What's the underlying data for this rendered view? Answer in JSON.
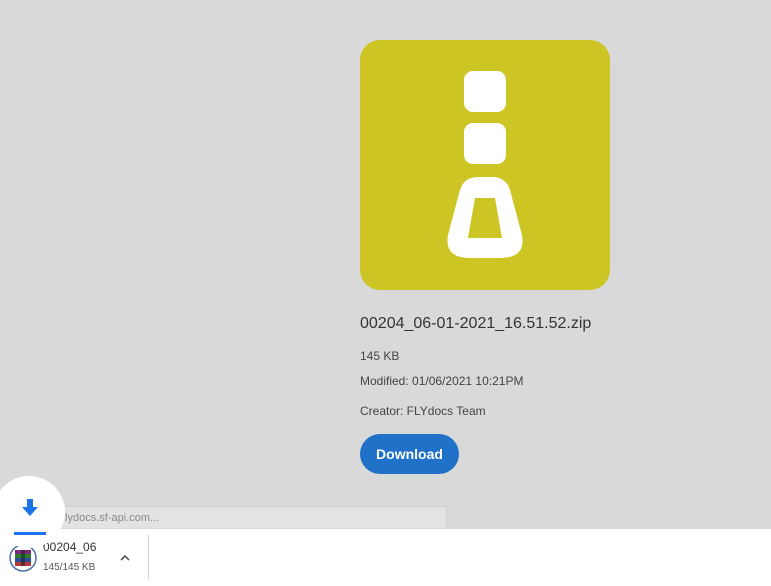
{
  "file": {
    "name": "00204_06-01-2021_16.51.52.zip",
    "size": "145 KB",
    "modified": "Modified: 01/06/2021 10:21PM",
    "creator": "Creator: FLYdocs Team",
    "icon": "zip-file-icon",
    "tile_color": "#cdc524"
  },
  "actions": {
    "download_label": "Download",
    "button_color": "#1f72c8"
  },
  "status_bar": {
    "url_text": "flydocs.sf-api.com..."
  },
  "download_shelf": {
    "item": {
      "name": "00204_06",
      "progress": "145/145 KB",
      "icon": "winrar-icon",
      "chevron": "chevron-up-icon"
    },
    "download_indicator_icon": "download-arrow-icon"
  }
}
